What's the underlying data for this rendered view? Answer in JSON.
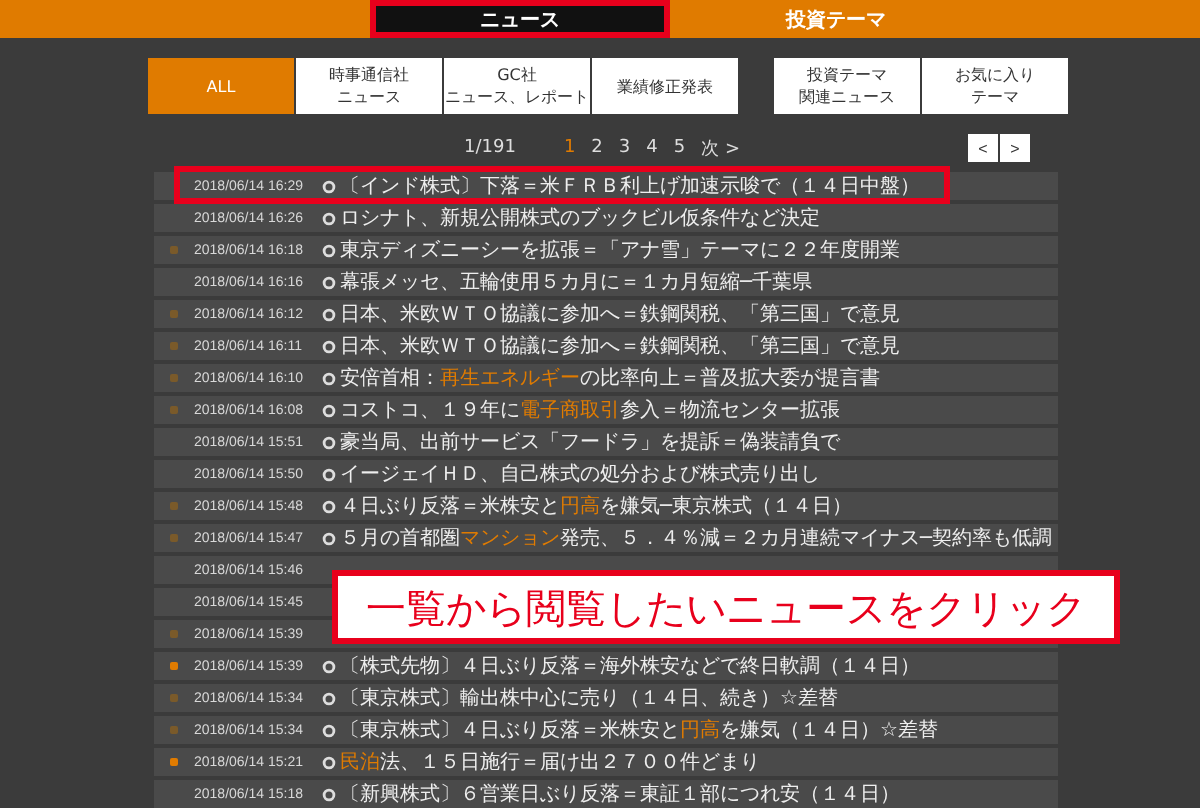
{
  "tabs": [
    {
      "label": "ニュース",
      "selected": true,
      "outlined": true
    },
    {
      "label": "投資テーマ",
      "selected": false,
      "outlined": false
    }
  ],
  "filter_groups": [
    {
      "buttons": [
        {
          "lines": [
            "ALL"
          ],
          "selected": true
        },
        {
          "lines": [
            "時事通信社",
            "ニュース"
          ],
          "selected": false
        },
        {
          "lines": [
            "GC社",
            "ニュース、レポート"
          ],
          "selected": false
        },
        {
          "lines": [
            "業績修正発表"
          ],
          "selected": false
        }
      ]
    },
    {
      "buttons": [
        {
          "lines": [
            "投資テーマ",
            "関連ニュース"
          ],
          "selected": false
        },
        {
          "lines": [
            "お気に入り",
            "テーマ"
          ],
          "selected": false
        }
      ]
    }
  ],
  "pagination": {
    "count": "1/191",
    "pages": [
      {
        "label": "1",
        "selected": true
      },
      {
        "label": "2",
        "selected": false
      },
      {
        "label": "3",
        "selected": false
      },
      {
        "label": "4",
        "selected": false
      },
      {
        "label": "5",
        "selected": false
      }
    ],
    "next": "次 >",
    "prev_button": "<",
    "next_button": ">"
  },
  "news": [
    {
      "time": "2018/06/14 16:29",
      "outlined": true,
      "title": [
        {
          "text": "〔インド株式〕下落＝米ＦＲＢ利上げ加速示唆で（１４日中盤）",
          "highlight": false
        }
      ]
    },
    {
      "time": "2018/06/14 16:26",
      "outlined": false,
      "title": [
        {
          "text": "ロシナト、新規公開株式のブックビル仮条件など決定",
          "highlight": false
        }
      ]
    },
    {
      "time": "2018/06/14 16:18",
      "color": "#7a5a2a",
      "outlined": false,
      "title": [
        {
          "text": "東京ディズニーシーを拡張＝「アナ雪」テーマに２２年度開業",
          "highlight": false
        }
      ]
    },
    {
      "time": "2018/06/14 16:16",
      "outlined": false,
      "title": [
        {
          "text": "幕張メッセ、五輪使用５カ月に＝１カ月短縮─千葉県",
          "highlight": false
        }
      ]
    },
    {
      "time": "2018/06/14 16:12",
      "color": "#7a5a2a",
      "outlined": false,
      "title": [
        {
          "text": "日本、米欧ＷＴＯ協議に参加へ＝鉄鋼関税、「第三国」で意見",
          "highlight": false
        }
      ]
    },
    {
      "time": "2018/06/14 16:11",
      "color": "#7a5a2a",
      "outlined": false,
      "title": [
        {
          "text": "日本、米欧ＷＴＯ協議に参加へ＝鉄鋼関税、「第三国」で意見",
          "highlight": false
        }
      ]
    },
    {
      "time": "2018/06/14 16:10",
      "color": "#7a5a2a",
      "outlined": false,
      "title": [
        {
          "text": "安倍首相：",
          "highlight": false
        },
        {
          "text": "再生エネルギー",
          "highlight": true
        },
        {
          "text": "の比率向上＝普及拡大委が提言書",
          "highlight": false
        }
      ]
    },
    {
      "time": "2018/06/14 16:08",
      "color": "#7a5a2a",
      "outlined": false,
      "title": [
        {
          "text": "コストコ、１９年に",
          "highlight": false
        },
        {
          "text": "電子商取引",
          "highlight": true
        },
        {
          "text": "参入＝物流センター拡張",
          "highlight": false
        }
      ]
    },
    {
      "time": "2018/06/14 15:51",
      "outlined": false,
      "title": [
        {
          "text": "豪当局、出前サービス「フードラ」を提訴＝偽装請負で",
          "highlight": false
        }
      ]
    },
    {
      "time": "2018/06/14 15:50",
      "outlined": false,
      "title": [
        {
          "text": "イージェイＨＤ、自己株式の処分および株式売り出し",
          "highlight": false
        }
      ]
    },
    {
      "time": "2018/06/14 15:48",
      "color": "#7a5a2a",
      "outlined": false,
      "title": [
        {
          "text": "４日ぶり反落＝米株安と",
          "highlight": false
        },
        {
          "text": "円高",
          "highlight": true
        },
        {
          "text": "を嫌気─東京株式（１４日）",
          "highlight": false
        }
      ]
    },
    {
      "time": "2018/06/14 15:47",
      "color": "#7a5a2a",
      "outlined": false,
      "title": [
        {
          "text": "５月の首都圏",
          "highlight": false
        },
        {
          "text": "マンション",
          "highlight": true
        },
        {
          "text": "発売、５．４％減＝２カ月連続マイナス─契約率も低調",
          "highlight": false
        }
      ]
    },
    {
      "time": "2018/06/14 15:46",
      "outlined": false
    },
    {
      "time": "2018/06/14 15:45",
      "outlined": false
    },
    {
      "time": "2018/06/14 15:39",
      "color": "#7a5a2a",
      "outlined": false
    },
    {
      "time": "2018/06/14 15:39",
      "color": "#e07b00",
      "outlined": false,
      "title": [
        {
          "text": "〔株式先物〕４日ぶり反落＝海外株安などで終日軟調（１４日）",
          "highlight": false
        }
      ]
    },
    {
      "time": "2018/06/14 15:34",
      "color": "#7a5a2a",
      "outlined": false,
      "title": [
        {
          "text": "〔東京株式〕輸出株中心に売り（１４日、続き）☆差替",
          "highlight": false
        }
      ]
    },
    {
      "time": "2018/06/14 15:34",
      "color": "#7a5a2a",
      "outlined": false,
      "title": [
        {
          "text": "〔東京株式〕４日ぶり反落＝米株安と",
          "highlight": false
        },
        {
          "text": "円高",
          "highlight": true
        },
        {
          "text": "を嫌気（１４日）☆差替",
          "highlight": false
        }
      ]
    },
    {
      "time": "2018/06/14 15:21",
      "color": "#e07b00",
      "outlined": false,
      "title": [
        {
          "text": "民泊",
          "highlight": true
        },
        {
          "text": "法、１５日施行＝届け出２７００件どまり",
          "highlight": false
        }
      ]
    },
    {
      "time": "2018/06/14 15:18",
      "outlined": false,
      "title": [
        {
          "text": "〔新興株式〕６営業日ぶり反落＝東証１部につれ安（１４日）",
          "highlight": false
        }
      ]
    }
  ],
  "callout": "一覧から閲覧したいニュースをクリック"
}
